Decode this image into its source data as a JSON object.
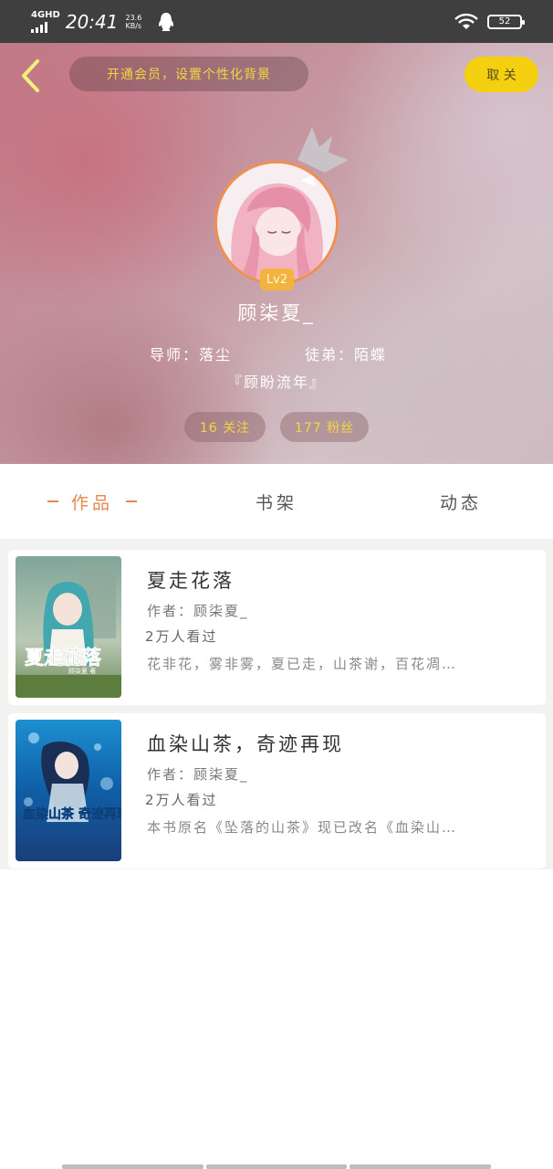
{
  "status_bar": {
    "network": "4GHD",
    "time": "20:41",
    "speed": "23.6 KB/s",
    "battery": "52"
  },
  "header": {
    "vip_banner": "开通会员，设置个性化背景",
    "cancel_label": "取 关"
  },
  "profile": {
    "level": "Lv2",
    "username": "顾柒夏_",
    "master": "导师：落尘",
    "apprentice": "徒弟：陌蝶",
    "signature": "『顾盼流年』",
    "follow_stat": "16 关注",
    "fans_stat": "177 粉丝"
  },
  "tabs": [
    {
      "label": "作品"
    },
    {
      "label": "书架"
    },
    {
      "label": "动态"
    }
  ],
  "books": [
    {
      "title": "夏走花落",
      "author": "作者：顾柒夏_",
      "readers": "2万人看过",
      "description": "花非花，雾非雾，夏已走，山茶谢，百花凋…",
      "cover_text": "夏走花落",
      "cover_author": "顾柒夏 著"
    },
    {
      "title": "血染山茶，奇迹再现",
      "author": "作者：顾柒夏_",
      "readers": "2万人看过",
      "description": "本书原名《坠落的山茶》现已改名《血染山…",
      "cover_text": "血染山茶 奇迹再现"
    }
  ],
  "colors": {
    "accent": "#e8864c",
    "gold": "#f5d542",
    "cancel_bg": "#f4d010",
    "level_bg": "#f2b43c"
  }
}
